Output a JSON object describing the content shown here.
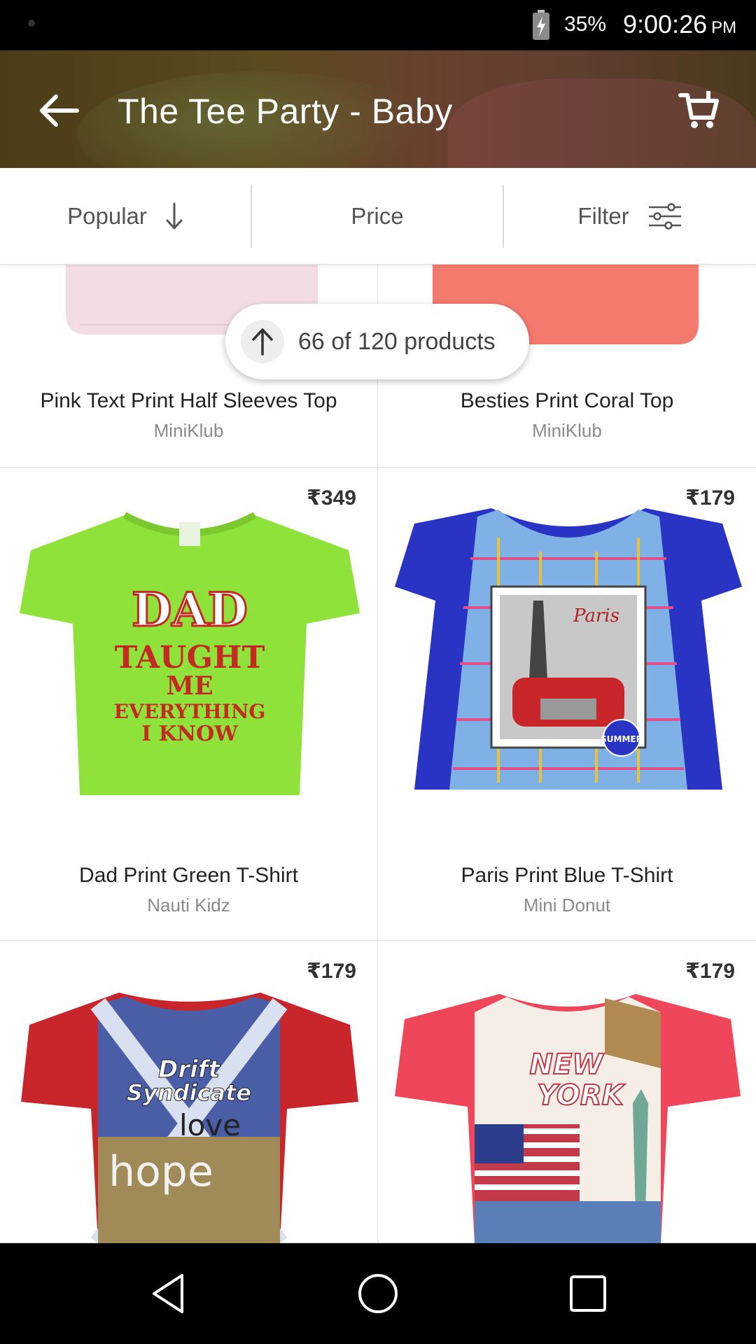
{
  "status_bar": {
    "battery_percent": "35%",
    "time": "9:00:26",
    "time_suffix": "PM",
    "icons": [
      "battery-charging-icon"
    ]
  },
  "app_bar": {
    "title": "The Tee Party - Baby",
    "icons": [
      "arrow-left-icon",
      "cart-icon"
    ]
  },
  "sort_bar": {
    "popular_label": "Popular",
    "price_label": "Price",
    "filter_label": "Filter",
    "icons": [
      "arrow-down-icon",
      "sliders-icon"
    ]
  },
  "counter": {
    "text": "66 of 120 products",
    "icon": "arrow-up-icon"
  },
  "products": [
    {
      "name": "Pink Text Print Half Sleeves Top",
      "brand": "MiniKlub",
      "price": ""
    },
    {
      "name": "Besties Print Coral Top",
      "brand": "MiniKlub",
      "price": ""
    },
    {
      "name": "Dad Print Green T-Shirt",
      "brand": "Nauti Kidz",
      "price": "₹349"
    },
    {
      "name": "Paris Print Blue T-Shirt",
      "brand": "Mini Donut",
      "price": "₹179"
    },
    {
      "name": "",
      "brand": "",
      "price": "₹179"
    },
    {
      "name": "",
      "brand": "",
      "price": "₹179"
    }
  ],
  "shirt_art": {
    "green_shirt_lines": [
      "DAD",
      "TAUGHT",
      "ME",
      "EVERYTHING",
      "I KNOW"
    ],
    "paris_shirt_lines": [
      "Paris",
      "SUMMER"
    ],
    "red_shirt_lines": [
      "Drift",
      "Syndicate",
      "love",
      "hope"
    ],
    "ny_shirt_lines": [
      "NEW",
      "YORK"
    ]
  },
  "colors": {
    "app_bar_bg": "#5a4a1e",
    "green_shirt": "#8fe23a",
    "blue_shirt": "#2a34c4",
    "red_shirt": "#c8262a",
    "coral_shirt": "#f57a6e",
    "pink_shirt": "#f2dde6"
  },
  "nav_bar": {
    "icons": [
      "back-triangle-icon",
      "home-circle-icon",
      "recents-square-icon"
    ]
  }
}
